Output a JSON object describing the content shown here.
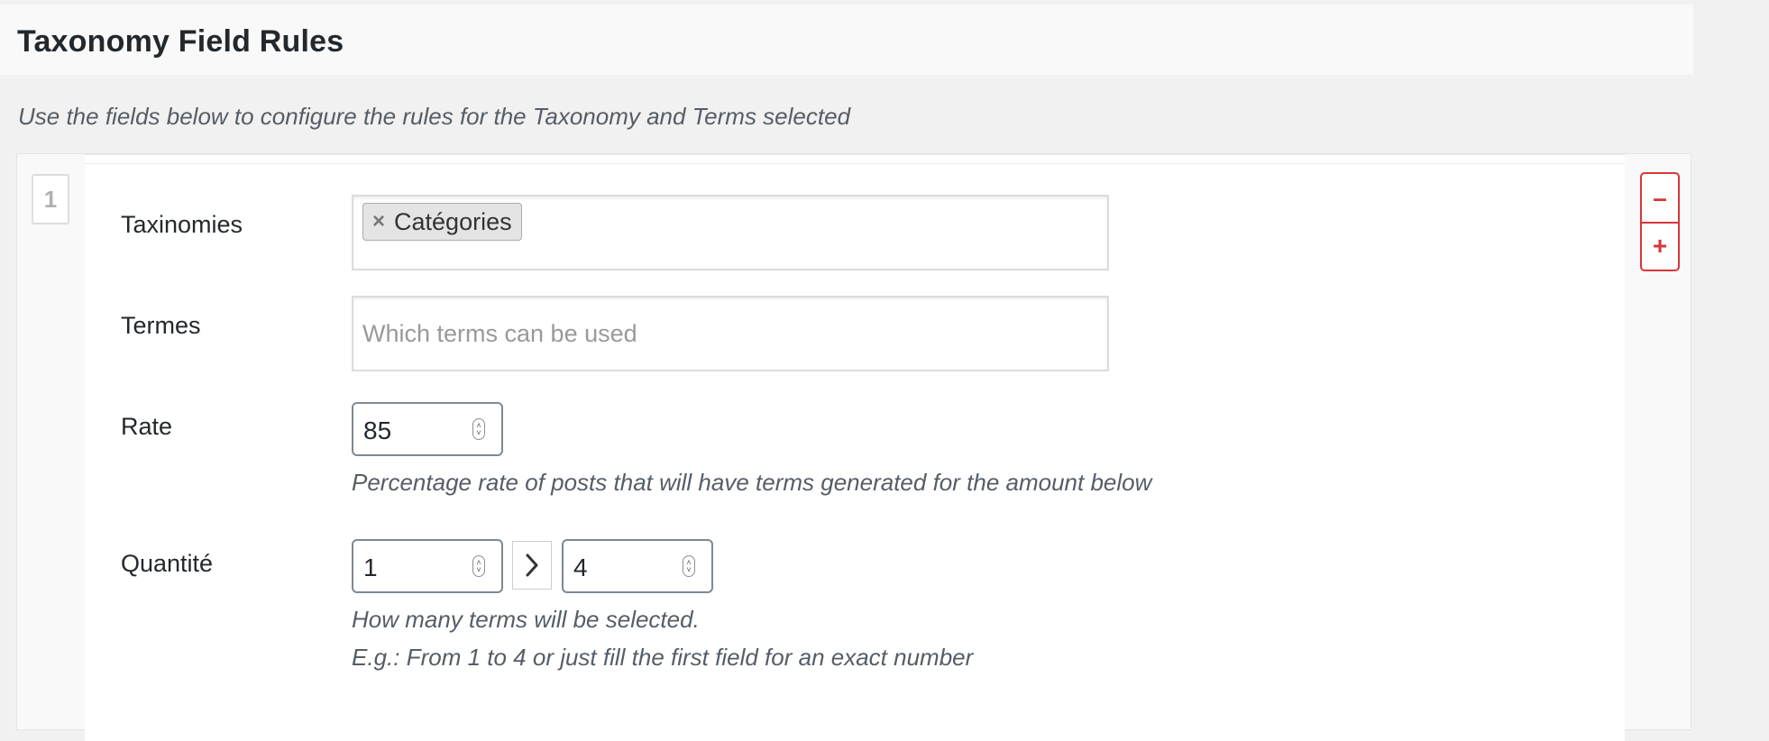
{
  "page": {
    "title": "Taxonomy Field Rules",
    "description": "Use the fields below to configure the rules for the Taxonomy and Terms selected"
  },
  "rule": {
    "index": "1",
    "remove_label": "–",
    "add_label": "+",
    "taxonomies": {
      "label": "Taxinomies",
      "selected": [
        "Catégories"
      ],
      "chip_remove": "×"
    },
    "terms": {
      "label": "Termes",
      "placeholder": "Which terms can be used"
    },
    "rate": {
      "label": "Rate",
      "value": "85",
      "help": "Percentage rate of posts that will have terms generated for the amount below"
    },
    "quantity": {
      "label": "Quantité",
      "min": "1",
      "max": "4",
      "help_line1": "How many terms will be selected.",
      "help_line2": "E.g.: From 1 to 4 or just fill the first field for an exact number"
    }
  },
  "colors": {
    "accent_danger": "#d63638",
    "background": "#f1f1f1",
    "panel": "#ffffff"
  },
  "icons": {
    "chip_remove": "close-icon",
    "range_separator": "chevron-right-icon",
    "spinner": "spinner-arrows-icon"
  }
}
